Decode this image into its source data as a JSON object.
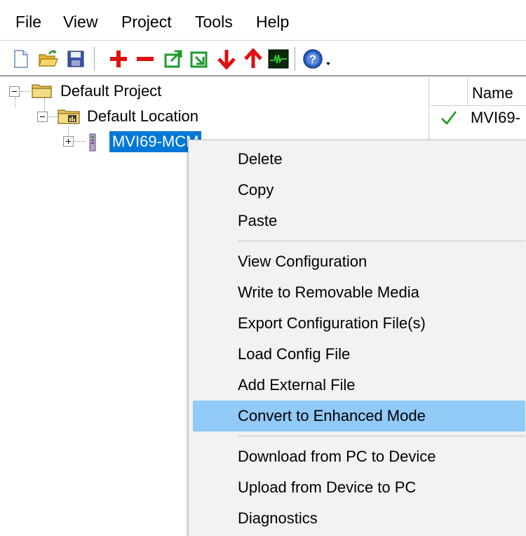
{
  "menubar": {
    "items": [
      "File",
      "View",
      "Project",
      "Tools",
      "Help"
    ]
  },
  "toolbar": {
    "icons": [
      "new-file-icon",
      "open-folder-icon",
      "save-icon",
      "add-icon",
      "remove-icon",
      "export-icon",
      "import-icon",
      "download-icon",
      "upload-icon",
      "diagnostics-icon",
      "help-icon"
    ]
  },
  "tree": {
    "root_label": "Default Project",
    "location_label": "Default Location",
    "module_label": "MVI69-MCM"
  },
  "list": {
    "header_name": "Name",
    "rows": [
      "MVI69-"
    ]
  },
  "context_menu": {
    "items": [
      "Delete",
      "Copy",
      "Paste",
      "View Configuration",
      "Write to Removable Media",
      "Export Configuration File(s)",
      "Load Config File",
      "Add External File",
      "Convert to Enhanced Mode",
      "Download from PC to Device",
      "Upload from Device to PC",
      "Diagnostics"
    ],
    "highlighted": "Convert to Enhanced Mode"
  },
  "colors": {
    "selection": "#0078d7",
    "menu_hover": "#91c9f7",
    "toolbar_red": "#e01010",
    "toolbar_green": "#1e9a2e",
    "check_green": "#1a9a1a"
  }
}
